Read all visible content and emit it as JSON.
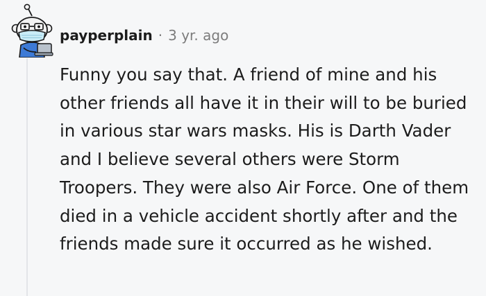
{
  "comment": {
    "username": "payperplain",
    "separator": "·",
    "timestamp": "3 yr. ago",
    "body": "Funny you say that. A friend of mine and his other friends all have it in their will to be buried in various star wars masks. His is Darth Vader and I believe several others were Storm Troopers. They were also Air Force. One of them died in a vehicle accident shortly after and the friends made sure it occurred as he wished."
  },
  "avatar": {
    "icon": "snoo-avatar-icon",
    "colors": {
      "skin": "#f0f0f0",
      "shirt": "#3d7ad6",
      "mask": "#c9ecf7",
      "glasses": "#3a3a3a",
      "laptop": "#b9c2cc"
    }
  }
}
